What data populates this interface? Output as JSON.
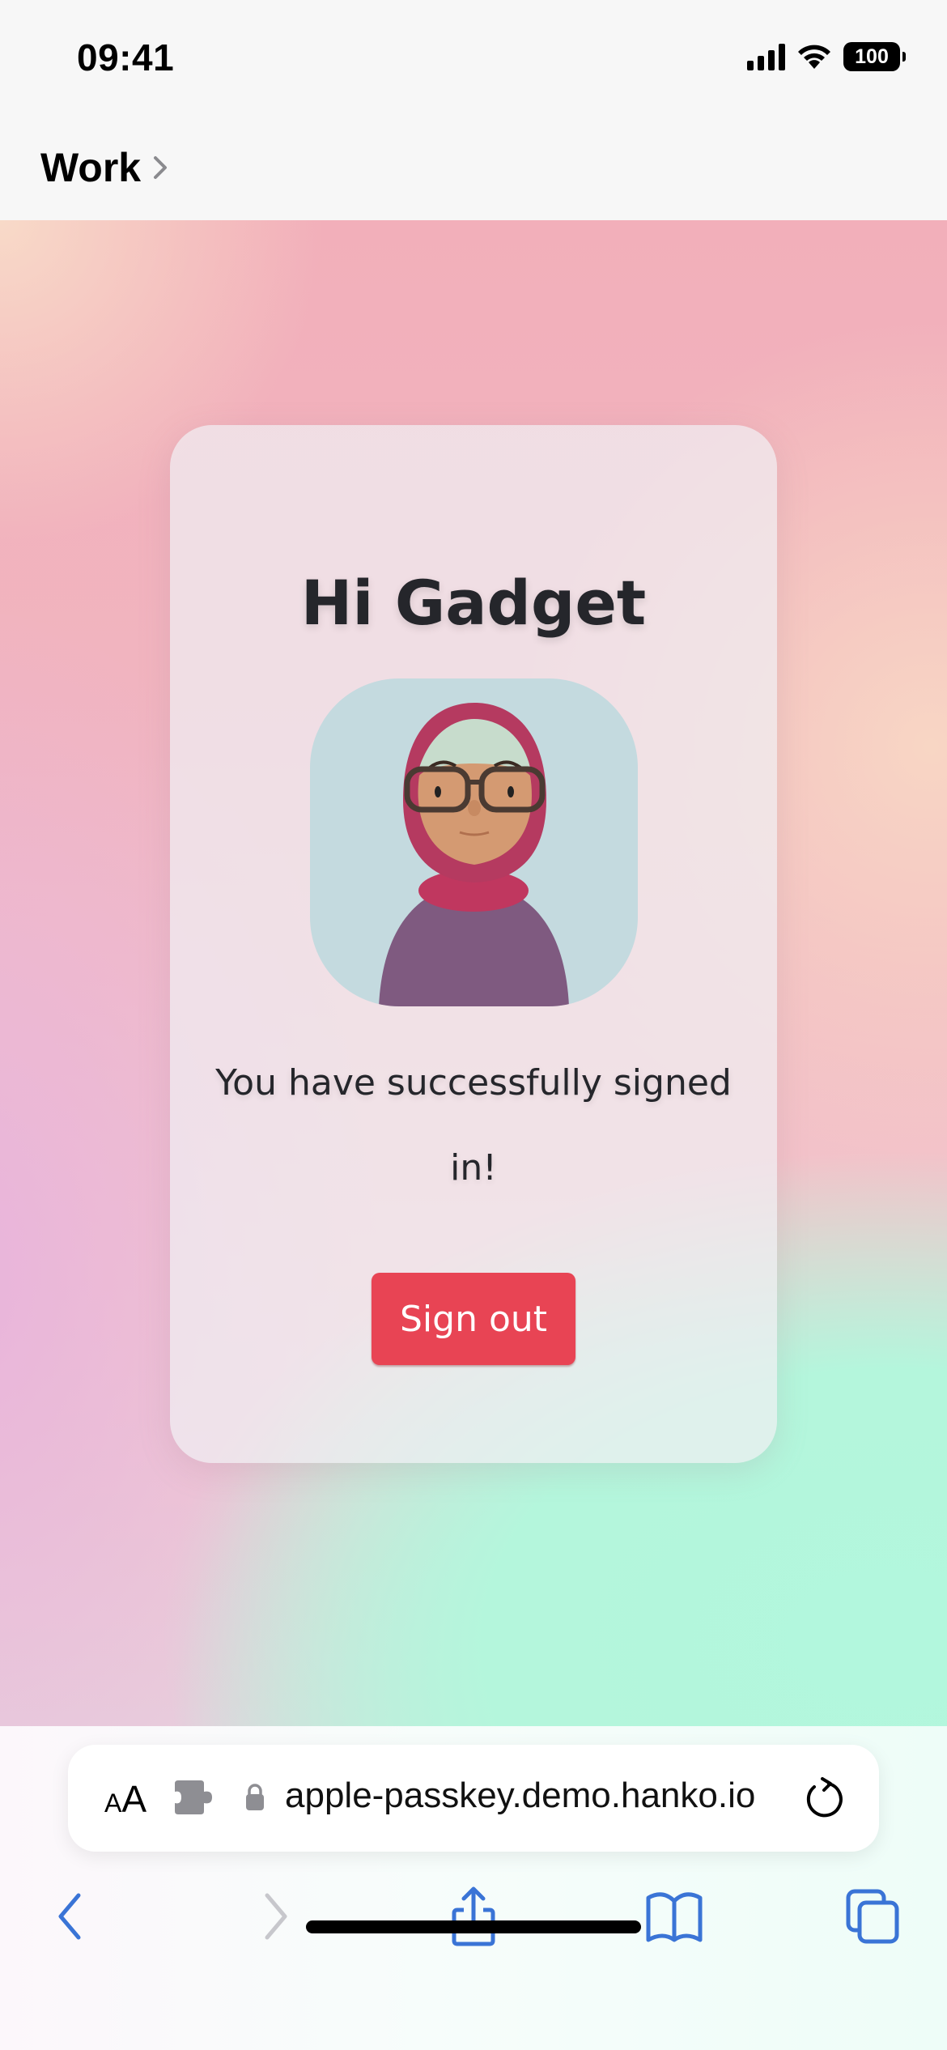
{
  "status_bar": {
    "time": "09:41",
    "battery": "100",
    "icons": [
      "cellular-signal-icon",
      "wifi-icon",
      "battery-icon"
    ]
  },
  "back_nav": {
    "label": "Work",
    "icon": "chevron-right-icon"
  },
  "page": {
    "title": "Hi Gadget",
    "avatar_alt": "avatar-illustration",
    "message": "You have successfully signed in!",
    "sign_out_label": "Sign out",
    "accent_color": "#e84454"
  },
  "browser": {
    "text_size_label_small": "A",
    "text_size_label_large": "A",
    "url": "apple-passkey.demo.hanko.io",
    "icons": {
      "text_size": "text-size-icon",
      "extension": "extension-puzzle-icon",
      "lock": "lock-icon",
      "reload": "reload-icon",
      "back": "chevron-left-icon",
      "forward": "chevron-right-icon",
      "share": "share-icon",
      "bookmarks": "book-icon",
      "tabs": "tabs-icon"
    },
    "tint_color": "#3a74d6"
  }
}
